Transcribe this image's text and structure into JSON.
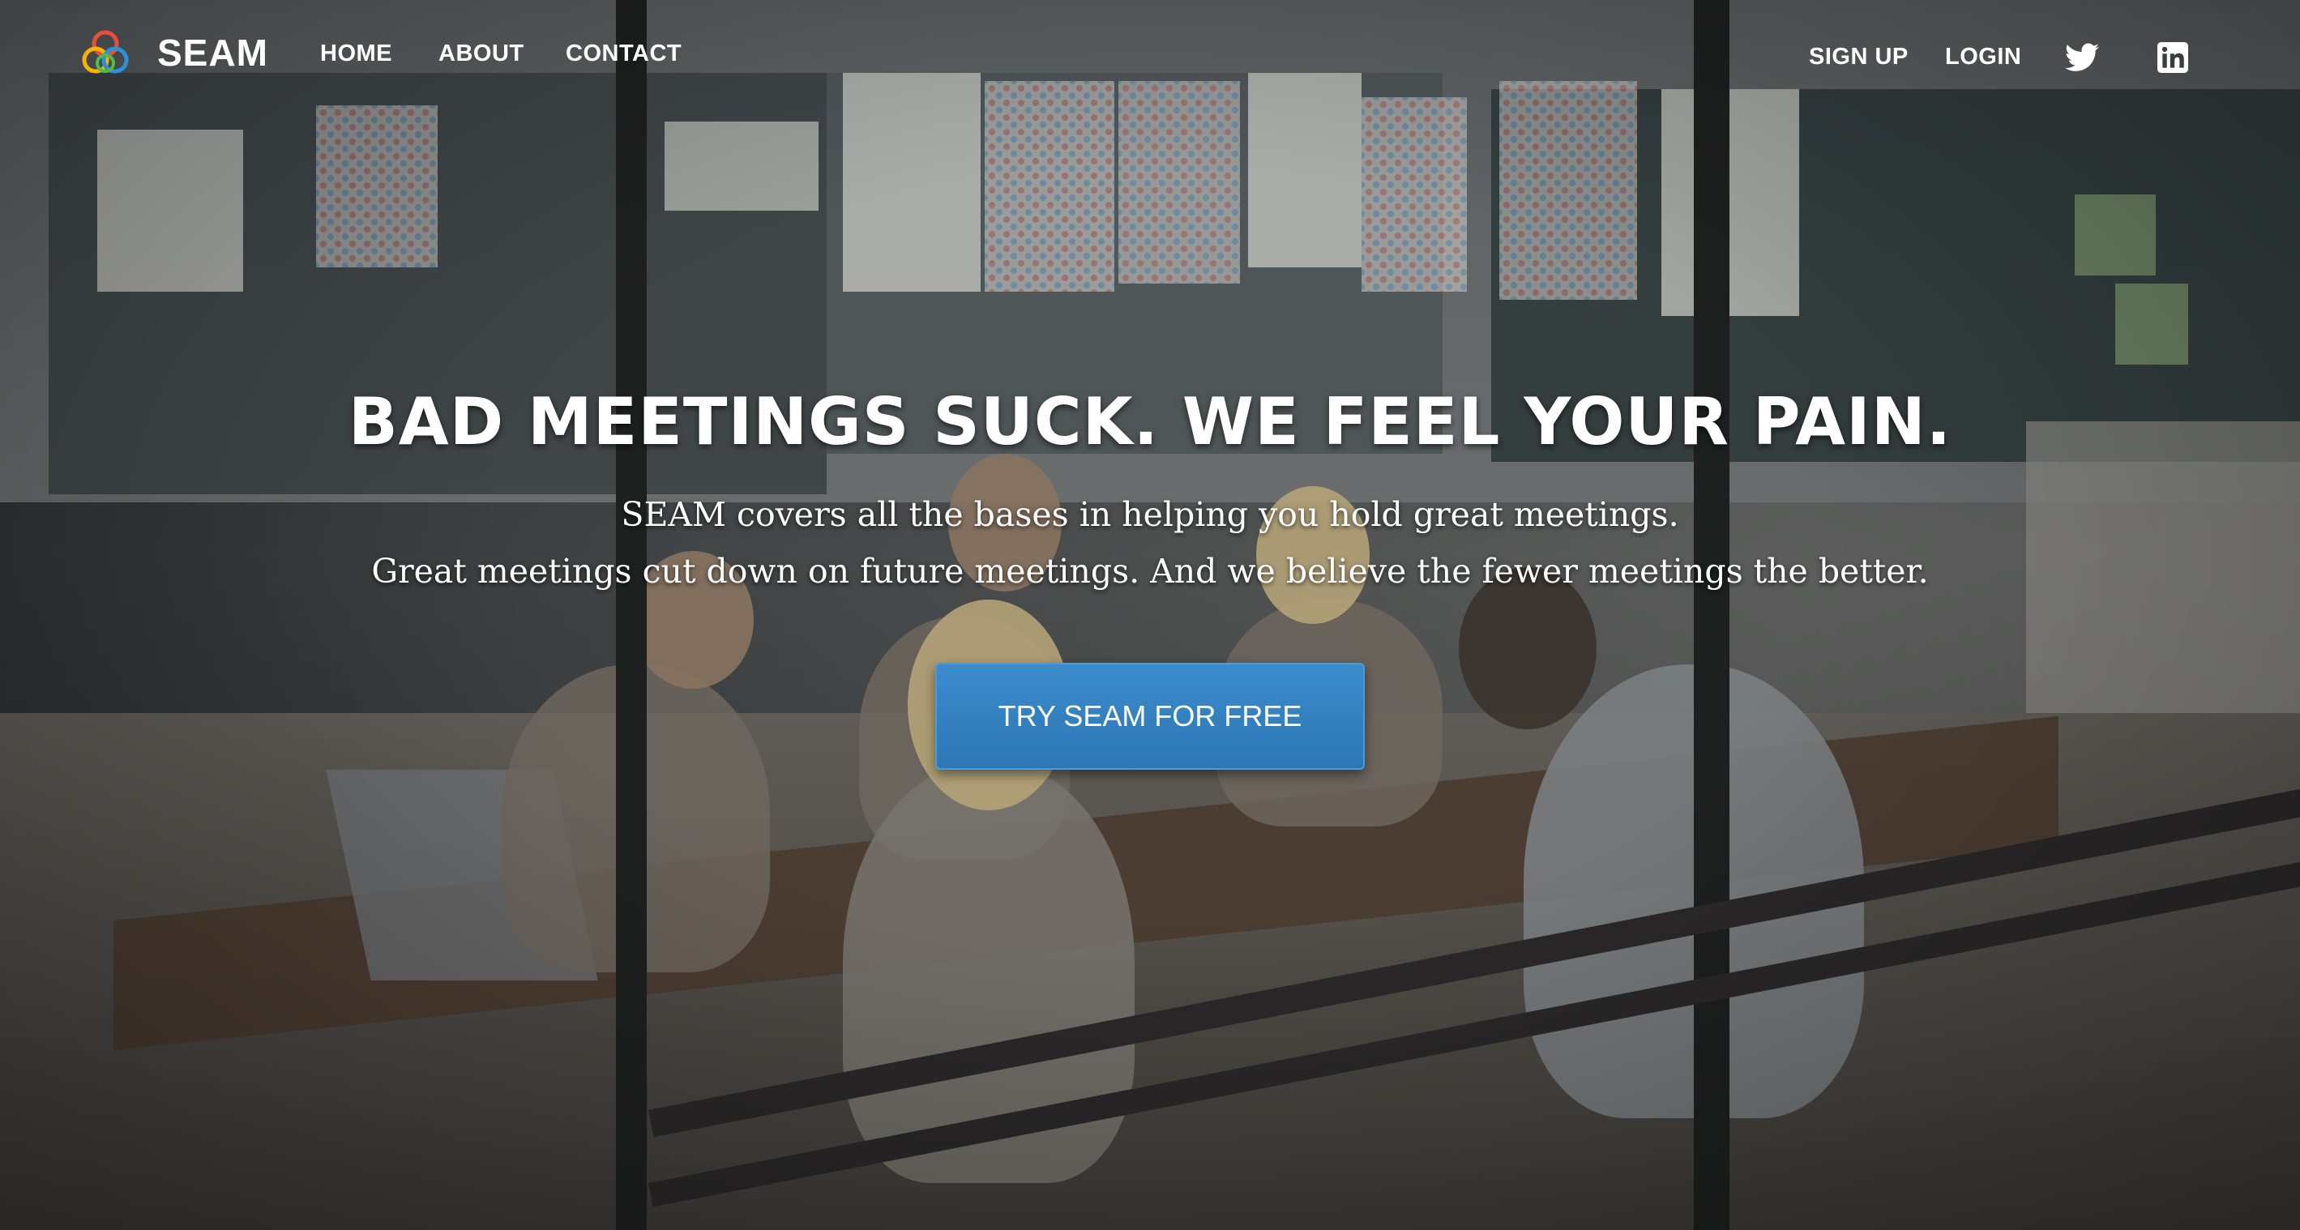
{
  "header": {
    "brand": "SEAM",
    "nav": {
      "home": "HOME",
      "about": "ABOUT",
      "contact": "CONTACT"
    },
    "auth": {
      "signup": "SIGN UP",
      "login": "LOGIN"
    },
    "social": {
      "twitter_icon": "twitter-icon",
      "linkedin_icon": "linkedin-icon"
    }
  },
  "hero": {
    "headline": "BAD MEETINGS SUCK. WE FEEL YOUR PAIN.",
    "sub_line_1": "SEAM covers all the bases in helping you hold great meetings.",
    "sub_line_2": "Great meetings cut down on future meetings. And we believe the fewer meetings the better.",
    "cta": "TRY SEAM FOR FREE"
  },
  "colors": {
    "accent": "#2d77b4",
    "text": "#ffffff"
  }
}
